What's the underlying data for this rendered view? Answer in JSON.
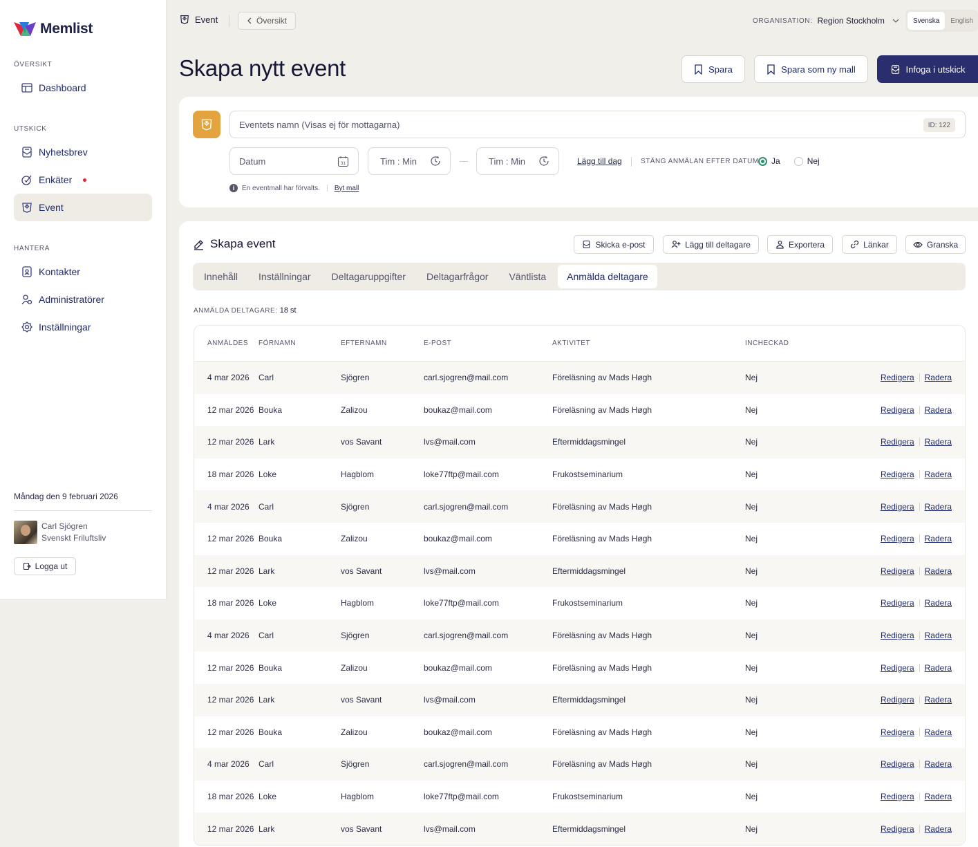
{
  "app": {
    "name": "Memlist"
  },
  "sidebar": {
    "sections": [
      {
        "label": "ÖVERSIKT",
        "items": [
          {
            "label": "Dashboard",
            "icon": "dashboard-icon"
          }
        ]
      },
      {
        "label": "UTSKICK",
        "items": [
          {
            "label": "Nyhetsbrev",
            "icon": "newsletter-icon"
          },
          {
            "label": "Enkäter",
            "icon": "survey-icon",
            "dot": true
          },
          {
            "label": "Event",
            "icon": "event-icon",
            "active": true
          }
        ]
      },
      {
        "label": "HANTERA",
        "items": [
          {
            "label": "Kontakter",
            "icon": "contacts-icon"
          },
          {
            "label": "Administratörer",
            "icon": "admins-icon"
          },
          {
            "label": "Inställningar",
            "icon": "settings-icon"
          }
        ]
      }
    ],
    "date": "Måndag den 9 februari 2026",
    "user": {
      "name": "Carl Sjögren",
      "org": "Svenskt Friluftsliv"
    },
    "logout_label": "Logga ut"
  },
  "topbar": {
    "current": "Event",
    "back_label": "Översikt",
    "org_label": "ORGANISATION:",
    "org_value": "Region Stockholm",
    "languages": [
      "Svenska",
      "English"
    ],
    "active_language": "Svenska"
  },
  "page": {
    "title": "Skapa nytt event",
    "actions": {
      "save": "Spara",
      "save_template": "Spara som ny mall",
      "insert": "Infoga i utskick"
    }
  },
  "event_form": {
    "name_placeholder": "Eventets namn  (Visas ej för mottagarna)",
    "id_badge": "ID: 122",
    "date_placeholder": "Datum",
    "calendar_day": "31",
    "time_hour": "Tim",
    "time_colon": ":",
    "time_min": "Min",
    "add_day": "Lägg till dag",
    "close_label": "STÄNG ANMÄLAN EFTER DATUM",
    "radio_yes": "Ja",
    "radio_no": "Nej",
    "info_text": "En eventmall har förvalts.",
    "info_link": "Byt mall"
  },
  "section": {
    "title": "Skapa event",
    "actions": {
      "send_email": "Skicka e-post",
      "add_participant": "Lägg till deltagare",
      "export": "Exportera",
      "links": "Länkar",
      "review": "Granska"
    },
    "tabs": [
      "Innehåll",
      "Inställningar",
      "Deltagaruppgifter",
      "Deltagarfrågor",
      "Väntlista",
      "Anmälda deltagare"
    ],
    "active_tab": "Anmälda deltagare",
    "count_label": "ANMÄLDA DELTAGARE:",
    "count_value": "18 st"
  },
  "table": {
    "columns": [
      "ANMÄLDES",
      "FÖRNAMN",
      "EFTERNAMN",
      "E-POST",
      "AKTIVITET",
      "INCHECKAD"
    ],
    "edit_label": "Redigera",
    "delete_label": "Radera",
    "rows": [
      [
        "4 mar 2026",
        "Carl",
        "Sjögren",
        "carl.sjogren@mail.com",
        "Föreläsning av Mads Høgh",
        "Nej"
      ],
      [
        "12 mar 2026",
        "Bouka",
        "Zalizou",
        "boukaz@mail.com",
        "Föreläsning av Mads Høgh",
        "Nej"
      ],
      [
        "12 mar 2026",
        "Lark",
        "vos Savant",
        "lvs@mail.com",
        "Eftermiddagsmingel",
        "Nej"
      ],
      [
        "18 mar 2026",
        "Loke",
        "Hagblom",
        "loke77ftp@mail.com",
        "Frukostseminarium",
        "Nej"
      ],
      [
        "4 mar 2026",
        "Carl",
        "Sjögren",
        "carl.sjogren@mail.com",
        "Föreläsning av Mads Høgh",
        "Nej"
      ],
      [
        "12 mar 2026",
        "Bouka",
        "Zalizou",
        "boukaz@mail.com",
        "Föreläsning av Mads Høgh",
        "Nej"
      ],
      [
        "12 mar 2026",
        "Lark",
        "vos Savant",
        "lvs@mail.com",
        "Eftermiddagsmingel",
        "Nej"
      ],
      [
        "18 mar 2026",
        "Loke",
        "Hagblom",
        "loke77ftp@mail.com",
        "Frukostseminarium",
        "Nej"
      ],
      [
        "4 mar 2026",
        "Carl",
        "Sjögren",
        "carl.sjogren@mail.com",
        "Föreläsning av Mads Høgh",
        "Nej"
      ],
      [
        "12 mar 2026",
        "Bouka",
        "Zalizou",
        "boukaz@mail.com",
        "Föreläsning av Mads Høgh",
        "Nej"
      ],
      [
        "12 mar 2026",
        "Lark",
        "vos Savant",
        "lvs@mail.com",
        "Eftermiddagsmingel",
        "Nej"
      ],
      [
        "12 mar 2026",
        "Bouka",
        "Zalizou",
        "boukaz@mail.com",
        "Föreläsning av Mads Høgh",
        "Nej"
      ],
      [
        "4 mar 2026",
        "Carl",
        "Sjögren",
        "carl.sjogren@mail.com",
        "Föreläsning av Mads Høgh",
        "Nej"
      ],
      [
        "18 mar 2026",
        "Loke",
        "Hagblom",
        "loke77ftp@mail.com",
        "Frukostseminarium",
        "Nej"
      ],
      [
        "12 mar 2026",
        "Lark",
        "vos Savant",
        "lvs@mail.com",
        "Eftermiddagsmingel",
        "Nej"
      ]
    ]
  },
  "colors": {
    "primary": "#2a2d6e",
    "event_badge": "#e3a33e",
    "radio_on": "#2a8f6a",
    "alert_dot": "#e0283c"
  }
}
